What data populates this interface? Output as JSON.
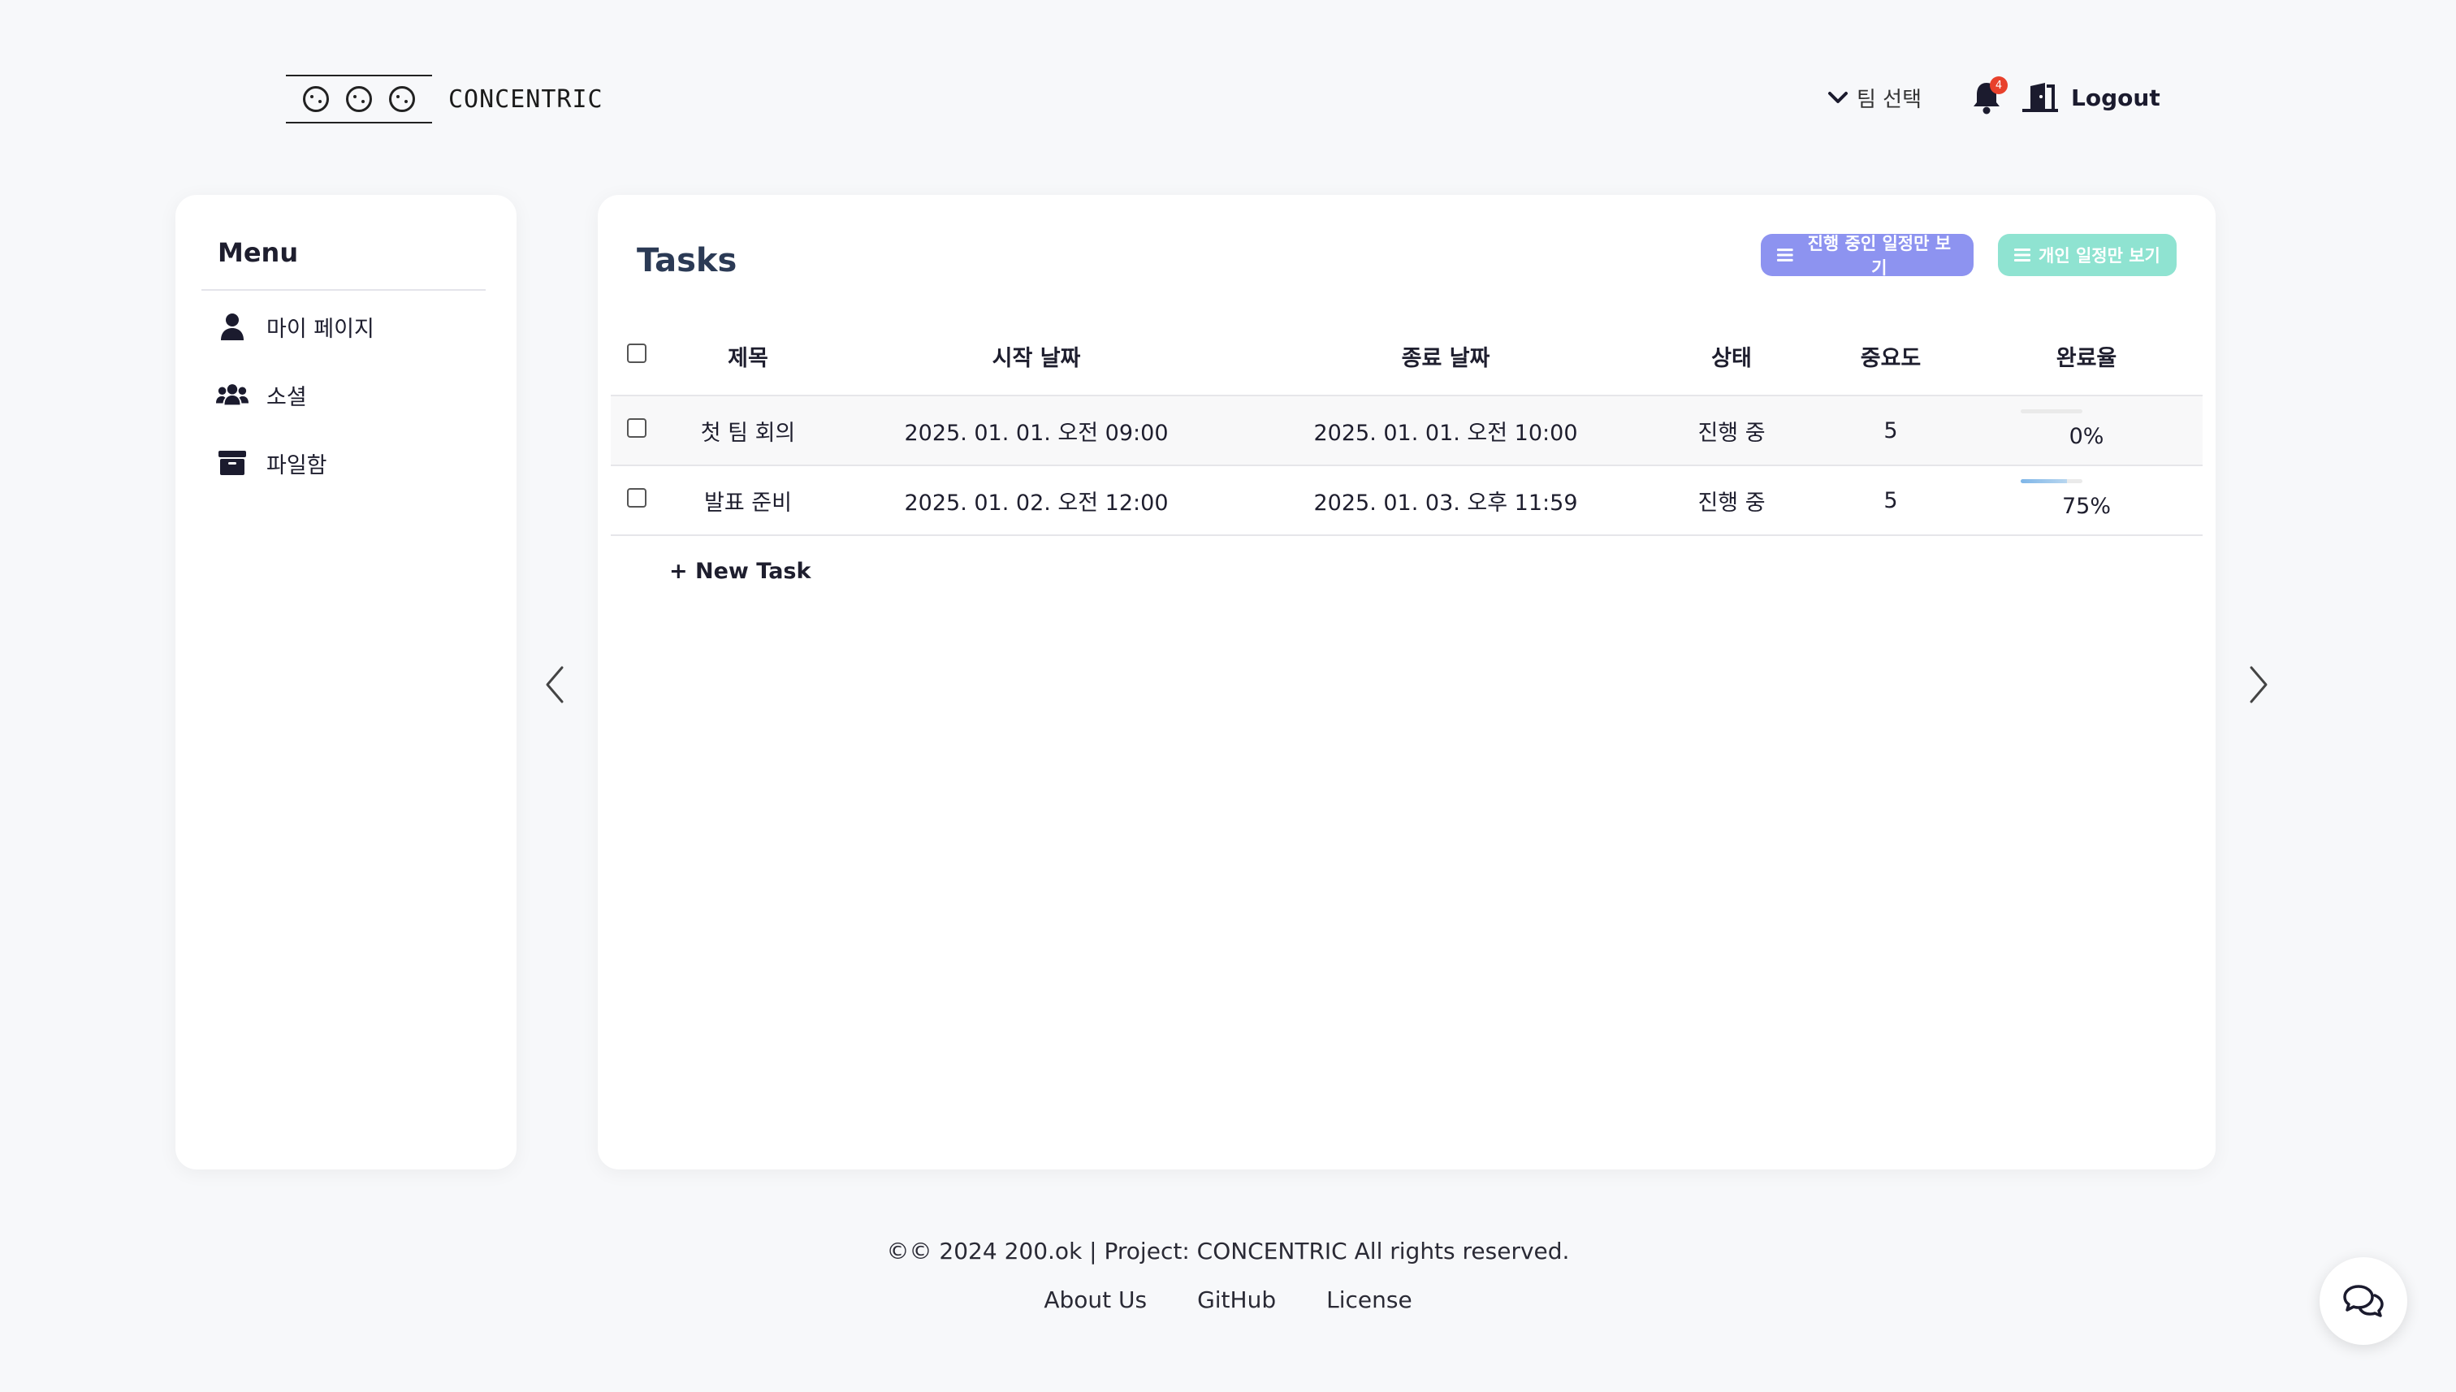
{
  "header": {
    "logo_text": "CONCENTRIC",
    "team_select_label": "팀 선택",
    "notification_count": "4",
    "logout_label": "Logout"
  },
  "sidebar": {
    "title": "Menu",
    "items": [
      {
        "label": "마이 페이지",
        "icon": "user-icon"
      },
      {
        "label": "소셜",
        "icon": "users-icon"
      },
      {
        "label": "파일함",
        "icon": "archive-icon"
      }
    ]
  },
  "main": {
    "title": "Tasks",
    "buttons": {
      "ongoing_label": "진행 중인 일정만 보기",
      "personal_label": "개인 일정만 보기"
    },
    "columns": [
      "제목",
      "시작 날짜",
      "종료 날짜",
      "상태",
      "중요도",
      "완료율"
    ],
    "rows": [
      {
        "title": "첫 팀 회의",
        "start": "2025. 01. 01. 오전 09:00",
        "end": "2025. 01. 01. 오전 10:00",
        "status": "진행 중",
        "priority": "5",
        "progress": "0%",
        "progress_value": 0
      },
      {
        "title": "발표 준비",
        "start": "2025. 01. 02. 오전 12:00",
        "end": "2025. 01. 03. 오후 11:59",
        "status": "진행 중",
        "priority": "5",
        "progress": "75%",
        "progress_value": 75
      }
    ],
    "new_task_label": "+ New Task"
  },
  "footer": {
    "copyright": "©© 2024 200.ok | Project: CONCENTRIC All rights reserved.",
    "links": [
      "About Us",
      "GitHub",
      "License"
    ]
  },
  "colors": {
    "ongoing_button": "#8d93f0",
    "personal_button": "#8fe3d1",
    "badge": "#e8412c"
  }
}
